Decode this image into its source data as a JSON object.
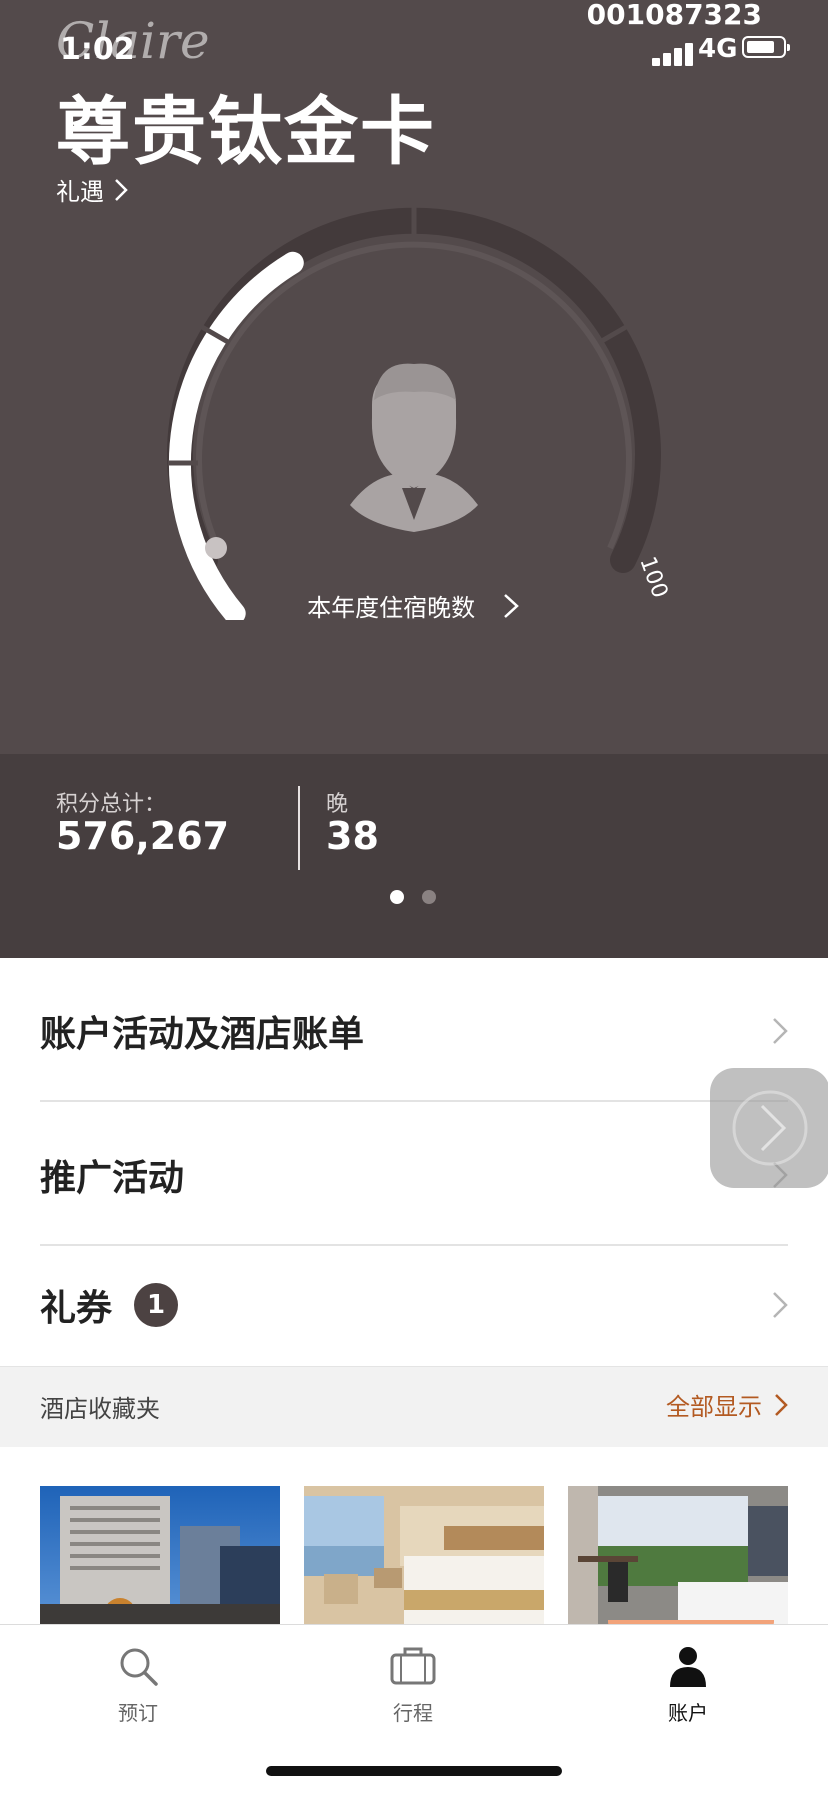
{
  "status_bar": {
    "time": "1:02",
    "network": "4G",
    "member_number": "001087323"
  },
  "header": {
    "brand": "Claire",
    "tier": "尊贵钛金卡",
    "benefits_link": "礼遇"
  },
  "gauge": {
    "current_nights": 38,
    "max_nights": 100,
    "max_label": "100",
    "caption": "本年度住宿晚数"
  },
  "stats": {
    "points": {
      "label": "积分总计：",
      "value": "576,267"
    },
    "nights": {
      "label": "晚",
      "value": "38"
    },
    "page_index": 0,
    "page_count": 2
  },
  "menu": {
    "activity": "账户活动及酒店账单",
    "promotions": "推广活动",
    "coupons": "礼券",
    "coupons_count": "1"
  },
  "favorites": {
    "title": "酒店收藏夹",
    "show_all": "全部显示"
  },
  "tabs": {
    "book": "预订",
    "trips": "行程",
    "account": "账户"
  },
  "colors": {
    "hero": "#534a4b",
    "stats": "#463e3f",
    "accent": "#b35a22"
  }
}
